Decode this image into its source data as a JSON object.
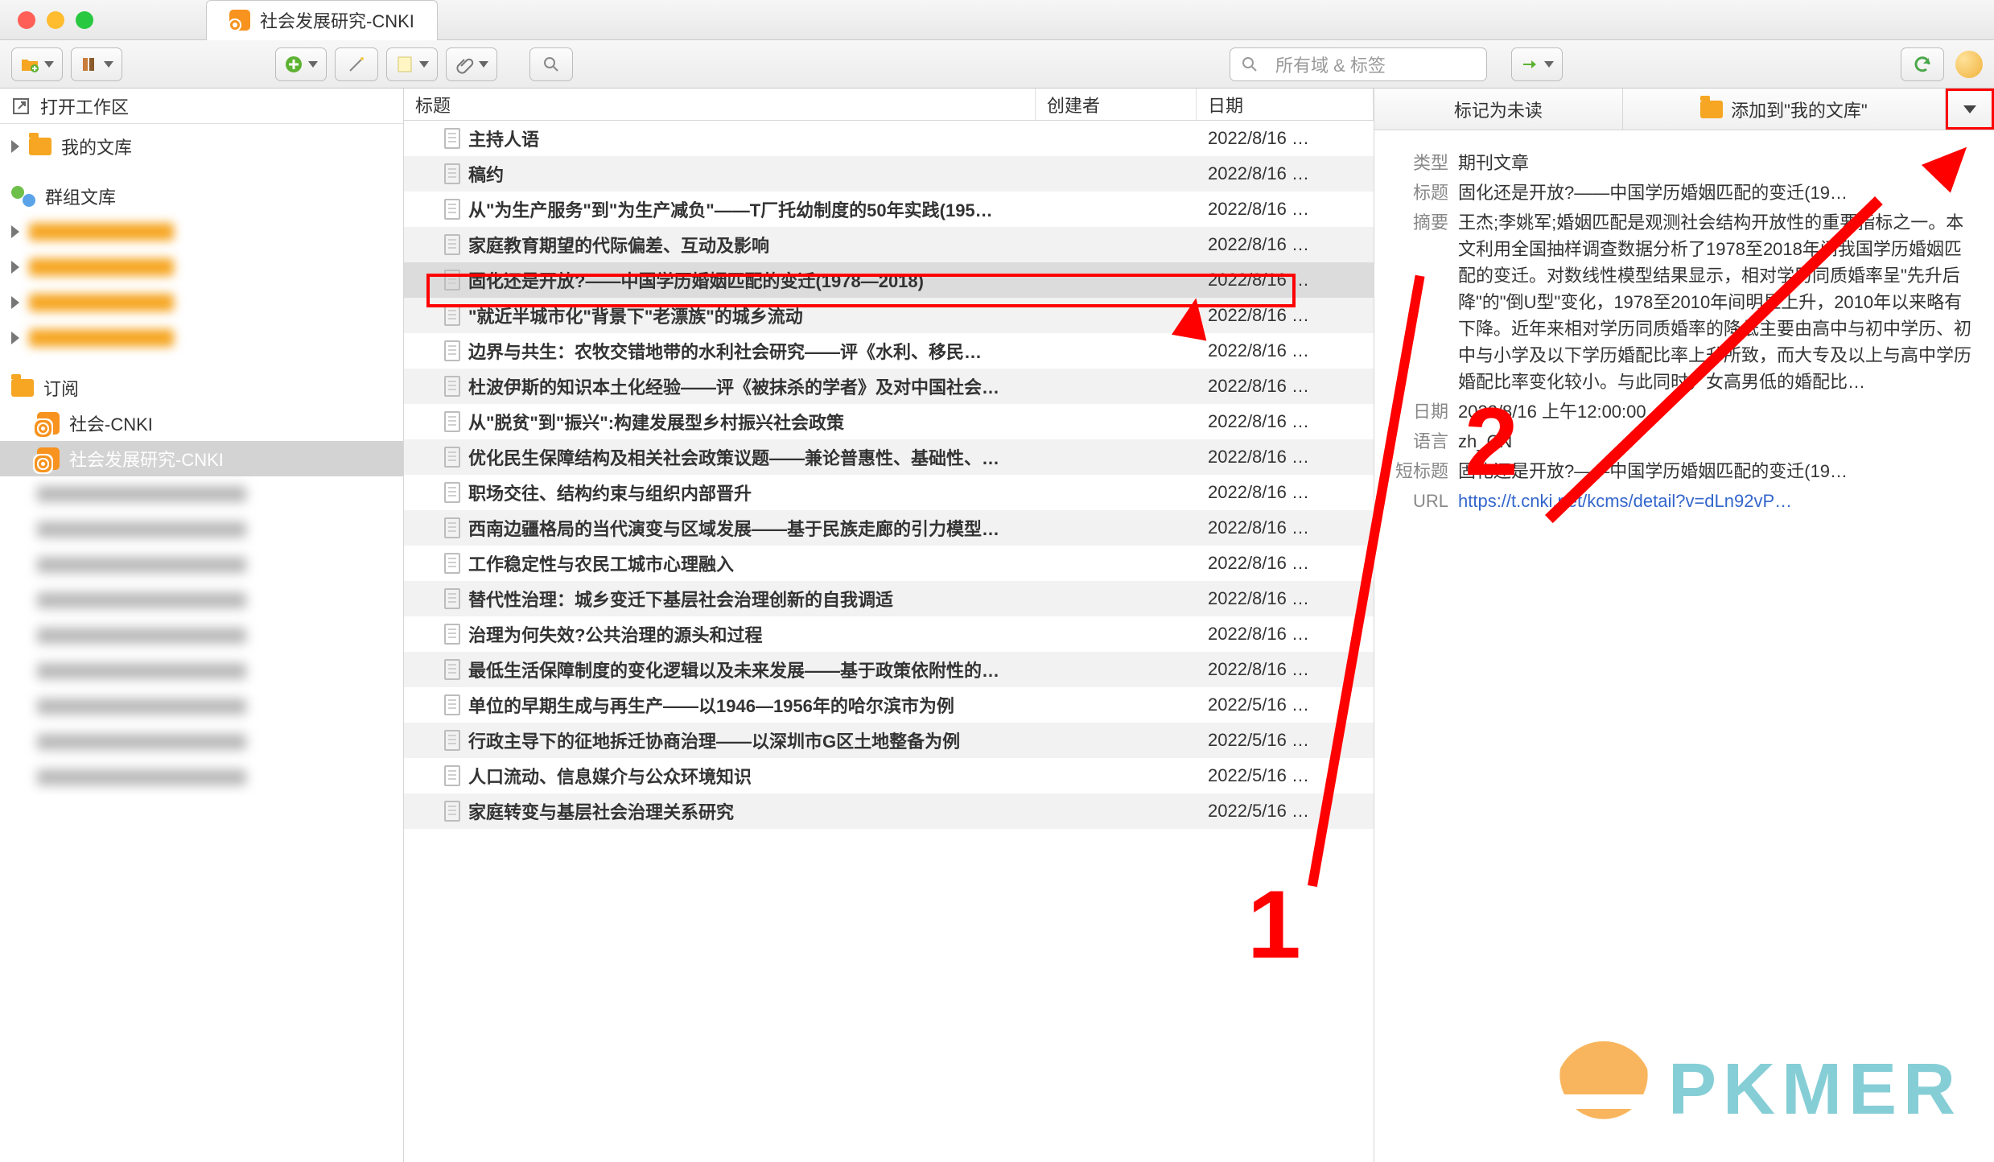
{
  "window": {
    "tab_title": "社会发展研究-CNKI"
  },
  "toolbar": {
    "search_placeholder": "所有域 & 标签"
  },
  "sidebar": {
    "open_workspace": "打开工作区",
    "my_library": "我的文库",
    "group_library": "群组文库",
    "feeds": "订阅",
    "feed_items": [
      "社会-CNKI",
      "社会发展研究-CNKI"
    ],
    "groups_blur": [
      "______",
      "__________",
      "__________",
      "__________"
    ],
    "feeds_blur": [
      "________",
      "________",
      "________",
      "________________",
      "____________________",
      "____________________",
      "____________________",
      "____________________",
      "____________________"
    ]
  },
  "columns": {
    "title": "标题",
    "creator": "创建者",
    "date": "日期"
  },
  "items": [
    {
      "title": "主持人语",
      "date": "2022/8/16 …"
    },
    {
      "title": "稿约",
      "date": "2022/8/16 …"
    },
    {
      "title": "从\"为生产服务\"到\"为生产减负\"——T厂托幼制度的50年实践(195…",
      "date": "2022/8/16 …"
    },
    {
      "title": "家庭教育期望的代际偏差、互动及影响",
      "date": "2022/8/16 …"
    },
    {
      "title": "固化还是开放?——中国学历婚姻匹配的变迁(1978—2018)",
      "date": "2022/8/16 …",
      "selected": true
    },
    {
      "title": "\"就近半城市化\"背景下\"老漂族\"的城乡流动",
      "date": "2022/8/16 …"
    },
    {
      "title": "边界与共生：农牧交错地带的水利社会研究——评《水利、移民…",
      "date": "2022/8/16 …"
    },
    {
      "title": "杜波伊斯的知识本土化经验——评《被抹杀的学者》及对中国社会…",
      "date": "2022/8/16 …"
    },
    {
      "title": "从\"脱贫\"到\"振兴\":构建发展型乡村振兴社会政策",
      "date": "2022/8/16 …"
    },
    {
      "title": "优化民生保障结构及相关社会政策议题——兼论普惠性、基础性、…",
      "date": "2022/8/16 …"
    },
    {
      "title": "职场交往、结构约束与组织内部晋升",
      "date": "2022/8/16 …"
    },
    {
      "title": "西南边疆格局的当代演变与区域发展——基于民族走廊的引力模型…",
      "date": "2022/8/16 …"
    },
    {
      "title": "工作稳定性与农民工城市心理融入",
      "date": "2022/8/16 …"
    },
    {
      "title": "替代性治理：城乡变迁下基层社会治理创新的自我调适",
      "date": "2022/8/16 …"
    },
    {
      "title": "治理为何失效?公共治理的源头和过程",
      "date": "2022/8/16 …"
    },
    {
      "title": "最低生活保障制度的变化逻辑以及未来发展——基于政策依附性的…",
      "date": "2022/8/16 …"
    },
    {
      "title": "单位的早期生成与再生产——以1946—1956年的哈尔滨市为例",
      "date": "2022/5/16 …"
    },
    {
      "title": "行政主导下的征地拆迁协商治理——以深圳市G区土地整备为例",
      "date": "2022/5/16 …"
    },
    {
      "title": "人口流动、信息媒介与公众环境知识",
      "date": "2022/5/16 …"
    },
    {
      "title": "家庭转变与基层社会治理关系研究",
      "date": "2022/5/16 …"
    }
  ],
  "detail": {
    "mark_unread": "标记为未读",
    "add_to_library": "添加到\"我的文库\"",
    "labels": {
      "type": "类型",
      "title": "标题",
      "abstract": "摘要",
      "date": "日期",
      "language": "语言",
      "short_title": "短标题",
      "url": "URL"
    },
    "type": "期刊文章",
    "title": "固化还是开放?——中国学历婚姻匹配的变迁(19…",
    "abstract": "王杰;李姚军;婚姻匹配是观测社会结构开放性的重要指标之一。本文利用全国抽样调查数据分析了1978至2018年间我国学历婚姻匹配的变迁。对数线性模型结果显示，相对学历同质婚率呈\"先升后降\"的\"倒U型\"变化，1978至2010年间明显上升，2010年以来略有下降。近年来相对学历同质婚率的降低主要由高中与初中学历、初中与小学及以下学历婚配比率上升所致，而大专及以上与高中学历婚配比率变化较小。与此同时，女高男低的婚配比…",
    "date": "2022/8/16 上午12:00:00",
    "language": "zh_CN",
    "short_title": "固化还是开放?——中国学历婚姻匹配的变迁(19…",
    "url": "https://t.cnki.net/kcms/detail?v=dLn92vP…"
  },
  "annotations": {
    "num1": "1",
    "num2": "2"
  },
  "watermark": "PKMER"
}
